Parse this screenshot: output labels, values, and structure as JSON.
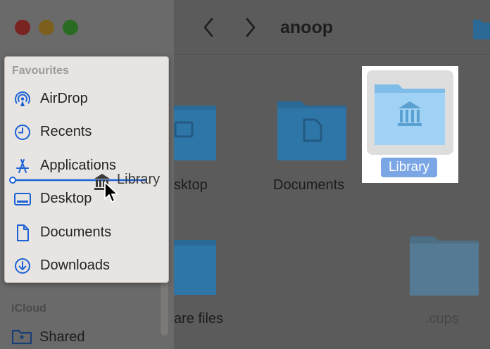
{
  "window": {
    "title": "anoop"
  },
  "sidebar": {
    "favourites_header": "Favourites",
    "items": [
      {
        "label": "AirDrop",
        "icon": "airdrop-icon"
      },
      {
        "label": "Recents",
        "icon": "clock-icon"
      },
      {
        "label": "Applications",
        "icon": "applications-icon"
      },
      {
        "label": "Desktop",
        "icon": "desktop-icon"
      },
      {
        "label": "Documents",
        "icon": "document-icon"
      },
      {
        "label": "Downloads",
        "icon": "downloads-icon"
      }
    ],
    "icloud_header": "iCloud",
    "icloud_items": [
      {
        "label": "Shared",
        "icon": "shared-folder-icon"
      }
    ]
  },
  "drag": {
    "label": "Library",
    "icon": "library-icon"
  },
  "folders": [
    {
      "label": "sktop"
    },
    {
      "label": "Documents"
    },
    {
      "label": "Library",
      "selected": true
    },
    {
      "label": "are files"
    },
    {
      "label": ".cups"
    }
  ],
  "colors": {
    "accent": "#1b62d6",
    "selection_label": "#7aa6e6",
    "folder_dim": "#2b6a96",
    "folder_light": "#8cc8f0"
  }
}
